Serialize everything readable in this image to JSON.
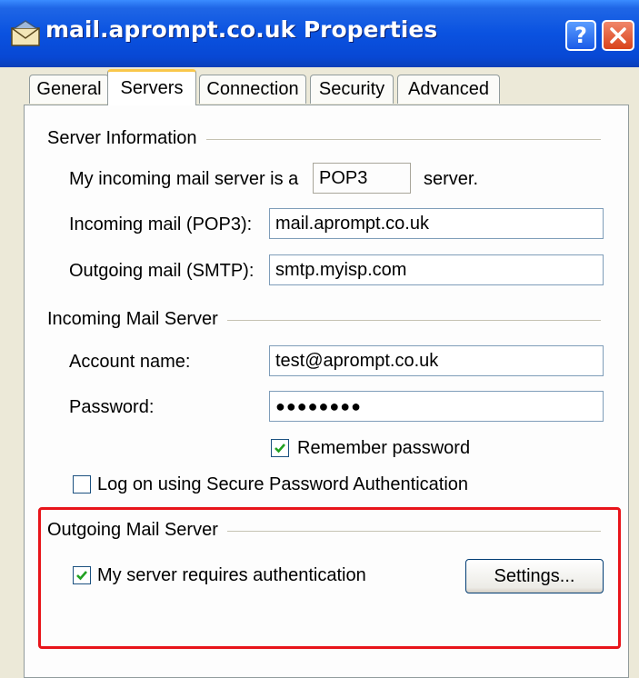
{
  "window": {
    "title": "mail.aprompt.co.uk Properties"
  },
  "tabs": [
    {
      "label": "General"
    },
    {
      "label": "Servers"
    },
    {
      "label": "Connection"
    },
    {
      "label": "Security"
    },
    {
      "label": "Advanced"
    }
  ],
  "active_tab": "Servers",
  "server_info": {
    "heading": "Server Information",
    "type_prefix": "My incoming mail server is a",
    "type_value": "POP3",
    "type_suffix": "server.",
    "incoming_label": "Incoming mail (POP3):",
    "incoming_value": "mail.aprompt.co.uk",
    "outgoing_label": "Outgoing mail (SMTP):",
    "outgoing_value": "smtp.myisp.com"
  },
  "incoming_server": {
    "heading": "Incoming Mail Server",
    "account_label": "Account name:",
    "account_value": "test@aprompt.co.uk",
    "password_label": "Password:",
    "password_value": "●●●●●●●●",
    "remember_label": "Remember password",
    "remember_checked": true,
    "spa_label": "Log on using Secure Password Authentication",
    "spa_checked": false
  },
  "outgoing_server": {
    "heading": "Outgoing Mail Server",
    "auth_label": "My server requires authentication",
    "auth_checked": true,
    "settings_label": "Settings..."
  },
  "colors": {
    "titlebar": "#0a52e0",
    "highlight": "#e8141a",
    "dialog": "#ece9d8",
    "check": "#21a121"
  }
}
